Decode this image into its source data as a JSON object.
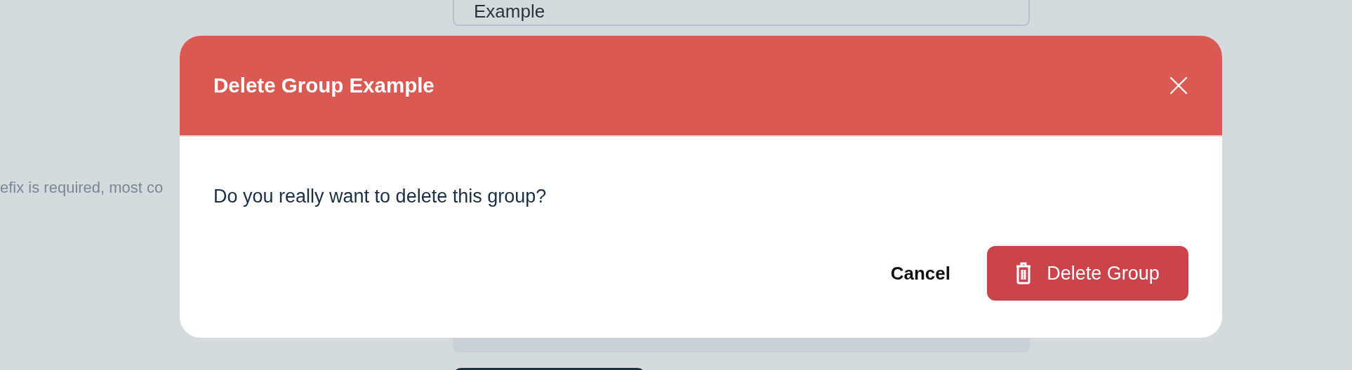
{
  "background": {
    "field_value": "Example",
    "helper_text": "efix is required, most co"
  },
  "dialog": {
    "title": "Delete Group Example",
    "message": "Do you really want to delete this group?",
    "buttons": [
      {
        "label": "Cancel",
        "kind": "text"
      },
      {
        "label": "Delete Group",
        "kind": "danger"
      }
    ]
  }
}
